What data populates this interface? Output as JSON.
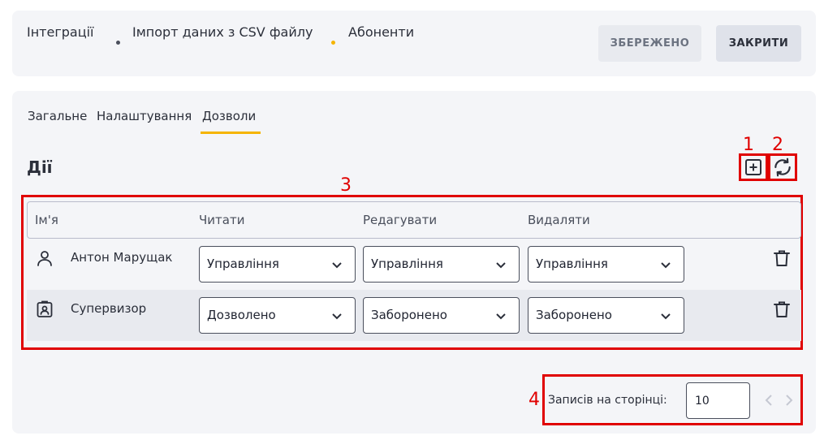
{
  "breadcrumb": {
    "items": [
      "Інтеграції",
      "Імпорт даних з CSV файлу",
      "Абоненти"
    ],
    "dot_colors": [
      "#4a4f5c",
      "#f5b400"
    ]
  },
  "header": {
    "saved_label": "ЗБЕРЕЖЕНО",
    "close_label": "ЗАКРИТИ"
  },
  "tabs": [
    {
      "label": "Загальне",
      "active": false
    },
    {
      "label": "Налаштування",
      "active": false
    },
    {
      "label": "Дозволи",
      "active": true
    }
  ],
  "section": {
    "title": "Дії",
    "add_icon": "plus-square-icon",
    "refresh_icon": "refresh-icon"
  },
  "annotations": [
    "1",
    "2",
    "3",
    "4"
  ],
  "table": {
    "columns": [
      "Ім'я",
      "Читати",
      "Редагувати",
      "Видаляти"
    ],
    "rows": [
      {
        "icon": "user-icon",
        "name": "Антон Марущак",
        "read": "Управління",
        "edit": "Управління",
        "delete": "Управління"
      },
      {
        "icon": "badge-icon",
        "name": "Супервизор",
        "read": "Дозволено",
        "edit": "Заборонено",
        "delete": "Заборонено"
      }
    ]
  },
  "pagination": {
    "label": "Записів на сторінці:",
    "per_page": "10"
  },
  "colors": {
    "accent": "#f5b400",
    "annotation": "#e00000"
  }
}
